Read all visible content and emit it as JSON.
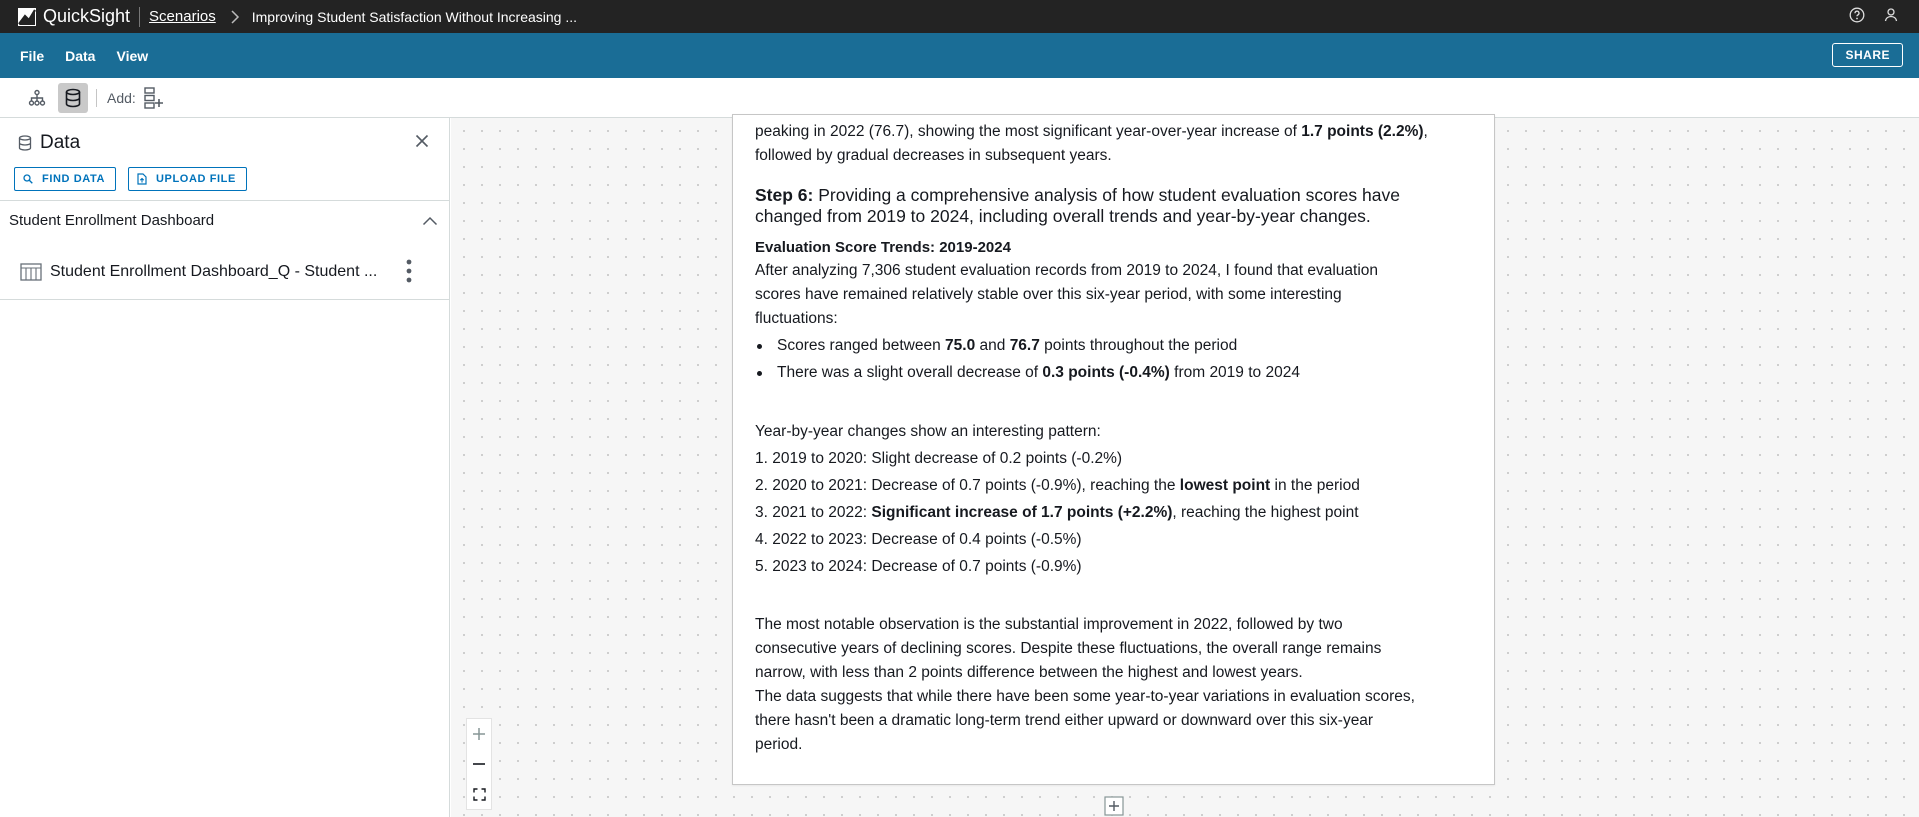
{
  "header": {
    "app_name": "QuickSight",
    "breadcrumb_link": "Scenarios",
    "breadcrumb_title": "Improving Student Satisfaction Without Increasing ..."
  },
  "menu": {
    "file": "File",
    "data": "Data",
    "view": "View",
    "share": "SHARE"
  },
  "toolbar": {
    "add_label": "Add:"
  },
  "panel": {
    "title": "Data",
    "find_data": "FIND DATA",
    "upload_file": "UPLOAD FILE",
    "section_title": "Student Enrollment Dashboard",
    "dataset_name": "Student Enrollment Dashboard_Q - Student ..."
  },
  "narrative": {
    "intro_line1_a": "peaking in 2022 (76.7), showing the most significant year-over-year increase of ",
    "intro_line1_b": "1.7 points (2.2%)",
    "intro_line1_c": ",",
    "intro_line2": "followed by gradual decreases in subsequent years.",
    "step6_label": "Step 6:",
    "step6_line1": " Providing a comprehensive analysis of how student evaluation scores have",
    "step6_line2": "changed from 2019 to 2024, including overall trends and year-by-year changes.",
    "heading": "Evaluation Score Trends: 2019-2024",
    "para1_l1": "After analyzing 7,306 student evaluation records from 2019 to 2024, I found that evaluation",
    "para1_l2": "scores have remained relatively stable over this six-year period, with some interesting",
    "para1_l3": "fluctuations:",
    "bullet1_a": "Scores ranged between ",
    "bullet1_b": "75.0",
    "bullet1_c": " and ",
    "bullet1_d": "76.7",
    "bullet1_e": " points throughout the period",
    "bullet2_a": "There was a slight overall decrease of ",
    "bullet2_b": "0.3 points (-0.4%)",
    "bullet2_c": " from 2019 to 2024",
    "yoy_intro": "Year-by-year changes show an interesting pattern:",
    "yoy1": "1. 2019 to 2020: Slight decrease of 0.2 points (-0.2%)",
    "yoy2_a": "2. 2020 to 2021: Decrease of 0.7 points (-0.9%), reaching the ",
    "yoy2_b": "lowest point",
    "yoy2_c": " in the period",
    "yoy3_a": "3. 2021 to 2022: ",
    "yoy3_b": "Significant increase of 1.7 points (+2.2%)",
    "yoy3_c": ", reaching the highest point",
    "yoy4": "4. 2022 to 2023: Decrease of 0.4 points (-0.5%)",
    "yoy5": "5. 2023 to 2024: Decrease of 0.7 points (-0.9%)",
    "concl_l1": "The most notable observation is the substantial improvement in 2022, followed by two",
    "concl_l2": "consecutive years of declining scores. Despite these fluctuations, the overall range remains",
    "concl_l3": "narrow, with less than 2 points difference between the highest and lowest years.",
    "concl_l4": "The data suggests that while there have been some year-to-year variations in evaluation scores,",
    "concl_l5": "there hasn't been a dramatic long-term trend either upward or downward over this six-year",
    "concl_l6": "period."
  },
  "colors": {
    "topbar": "#232323",
    "menubar": "#1a6d96",
    "accent": "#0073bb"
  }
}
